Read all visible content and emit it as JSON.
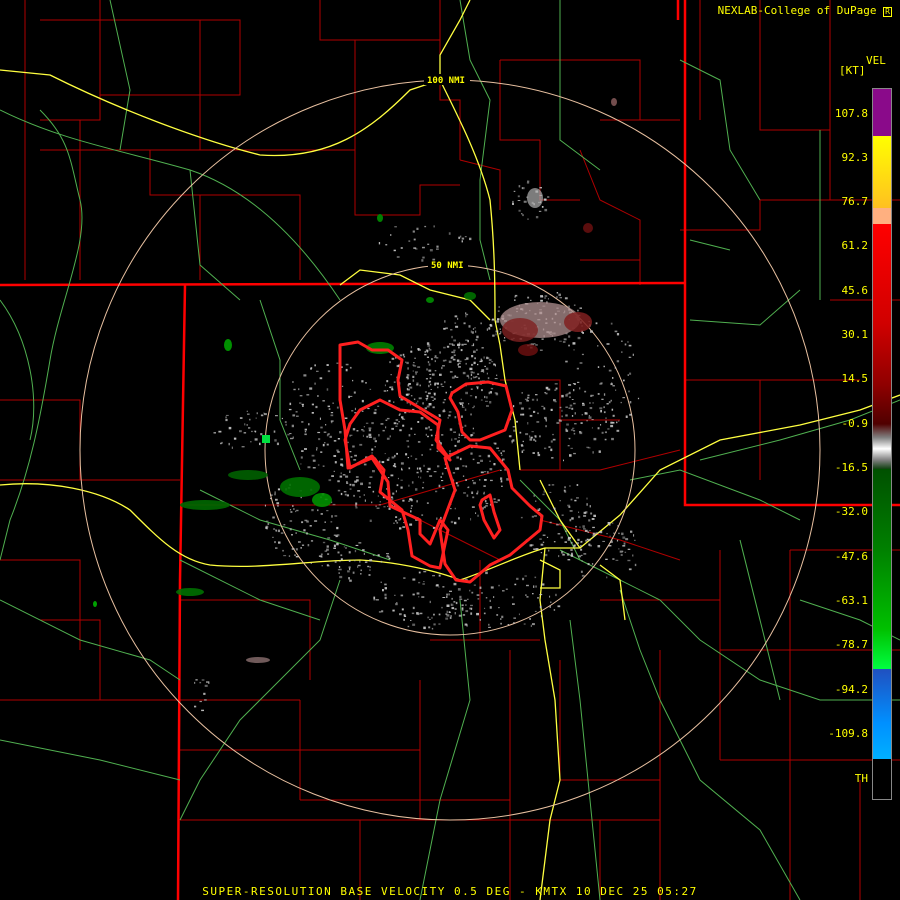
{
  "header": {
    "credit": "NEXLAB-College of DuPage",
    "credit_mark": "R"
  },
  "legend": {
    "title": "VEL",
    "unit": "[KT]",
    "labels": [
      "107.8",
      "92.3",
      "76.7",
      "61.2",
      "45.6",
      "30.1",
      "14.5",
      "-0.9",
      "-16.5",
      "-32.0",
      "-47.6",
      "-63.1",
      "-78.7",
      "-94.2",
      "-109.8",
      "TH"
    ],
    "colors": {
      "purple": "#8a0a8a",
      "yellow": "#ffff00",
      "peach": "#ffb080",
      "red": "#ff0000",
      "dark_red": "#700000",
      "gray": "#c0c0c0",
      "dark_green": "#005000",
      "green": "#00c000",
      "bright_green": "#00ff40",
      "blue": "#2050c0",
      "cyan": "#00b0ff"
    }
  },
  "map": {
    "rings": [
      {
        "label": "50 NMI"
      },
      {
        "label": "100 NMI"
      }
    ],
    "colors": {
      "state_border": "#ff0000",
      "county_border": "#c00000",
      "highway": "#ffff40",
      "road": "#60c060",
      "ring": "#e8c0a0",
      "warning_polygon": "#ff2020"
    }
  },
  "footer": {
    "caption": "SUPER-RESOLUTION BASE VELOCITY 0.5 DEG - KMTX 10 DEC 25 05:27"
  }
}
